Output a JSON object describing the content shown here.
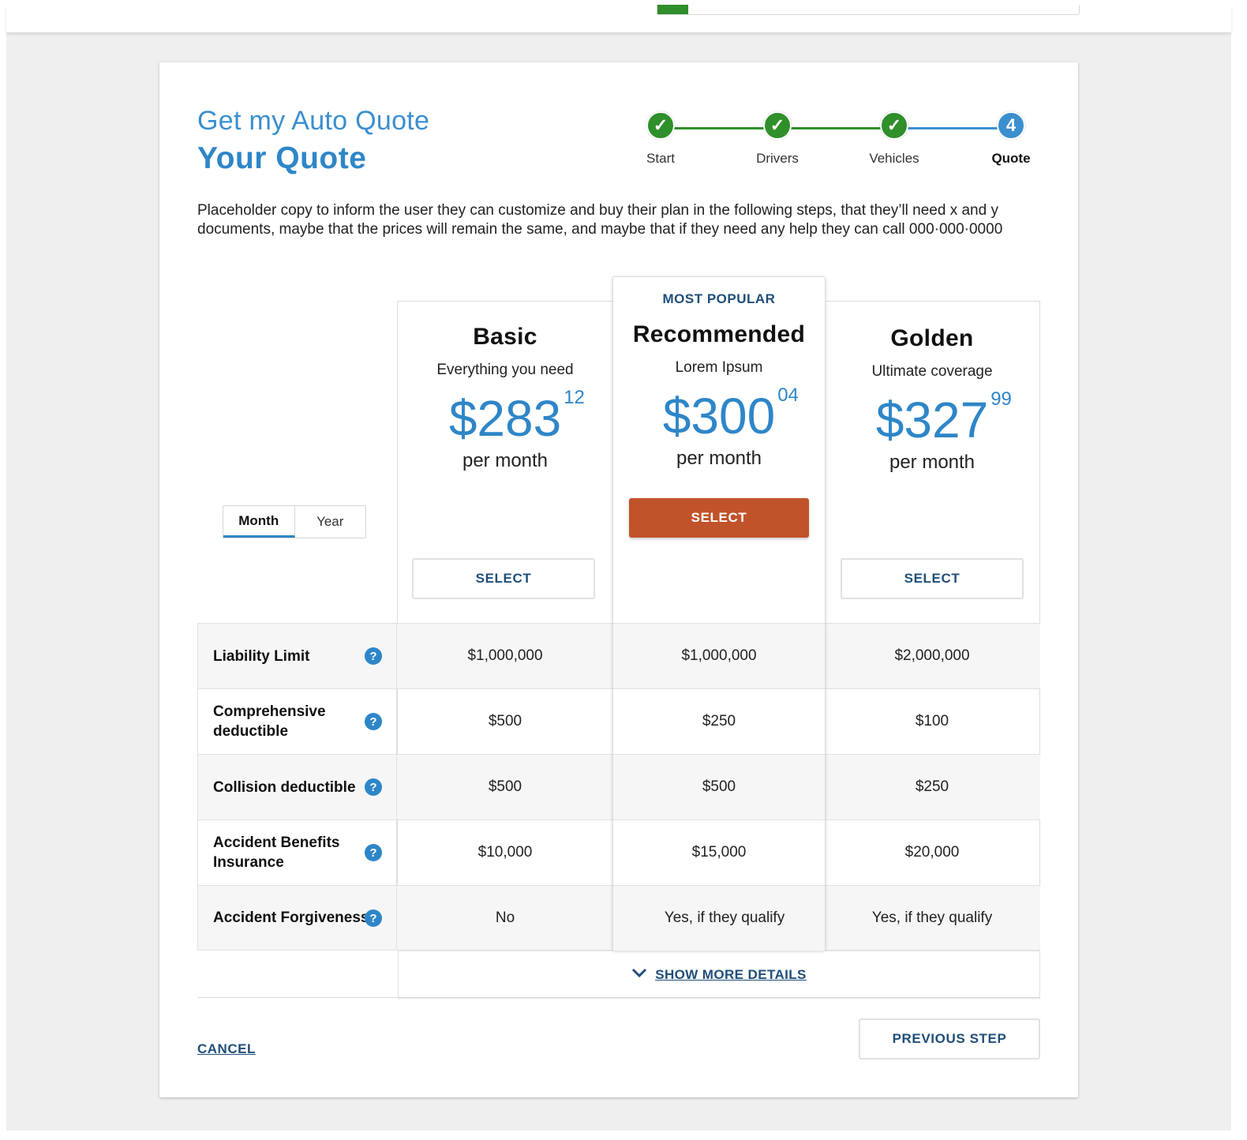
{
  "header": {
    "title_line1": "Get my Auto Quote",
    "title_line2": "Your Quote"
  },
  "stepper": {
    "steps": [
      {
        "label": "Start",
        "state": "done",
        "icon": "check-icon"
      },
      {
        "label": "Drivers",
        "state": "done",
        "icon": "check-icon"
      },
      {
        "label": "Vehicles",
        "state": "done",
        "icon": "check-icon"
      },
      {
        "label": "Quote",
        "state": "active",
        "number": "4"
      }
    ],
    "colors": {
      "done": "#2f8f2a",
      "active": "#3b8fcf"
    }
  },
  "intro": "Placeholder copy to inform the user they can customize and buy their plan in the following steps, that they’ll need x and y documents, maybe that the prices will remain the same, and maybe that if  they need any help they can call 000·000·0000",
  "billing_toggle": {
    "options": [
      "Month",
      "Year"
    ],
    "selected": "Month"
  },
  "plans": [
    {
      "name": "Basic",
      "subtitle": "Everything you need",
      "price_main": "$283",
      "price_cents": "12",
      "period": "per month",
      "button": "SELECT"
    },
    {
      "badge": "MOST POPULAR",
      "name": "Recommended",
      "subtitle": "Lorem Ipsum",
      "price_main": "$300",
      "price_cents": "04",
      "period": "per month",
      "button": "SELECT"
    },
    {
      "name": "Golden",
      "subtitle": "Ultimate coverage",
      "price_main": "$327",
      "price_cents": "99",
      "period": "per month",
      "button": "SELECT"
    }
  ],
  "features": [
    {
      "label": "Liability Limit",
      "values": [
        "$1,000,000",
        "$1,000,000",
        "$2,000,000"
      ]
    },
    {
      "label": "Comprehensive deductible",
      "values": [
        "$500",
        "$250",
        "$100"
      ]
    },
    {
      "label": "Collision deductible",
      "values": [
        "$500",
        "$500",
        "$250"
      ]
    },
    {
      "label": "Accident Benefits Insurance",
      "values": [
        "$10,000",
        "$15,000",
        "$20,000"
      ]
    },
    {
      "label": "Accident Forgiveness",
      "values": [
        "No",
        "Yes,  if  they qualify",
        "Yes,  if  they qualify"
      ]
    }
  ],
  "help_icon_glyph": "?",
  "show_more": "SHOW MORE DETAILS",
  "footer": {
    "cancel": "CANCEL",
    "previous": "PREVIOUS STEP"
  },
  "colors": {
    "accent": "#2e86c8",
    "primary_button": "#c1532a",
    "link": "#1f4e79"
  }
}
